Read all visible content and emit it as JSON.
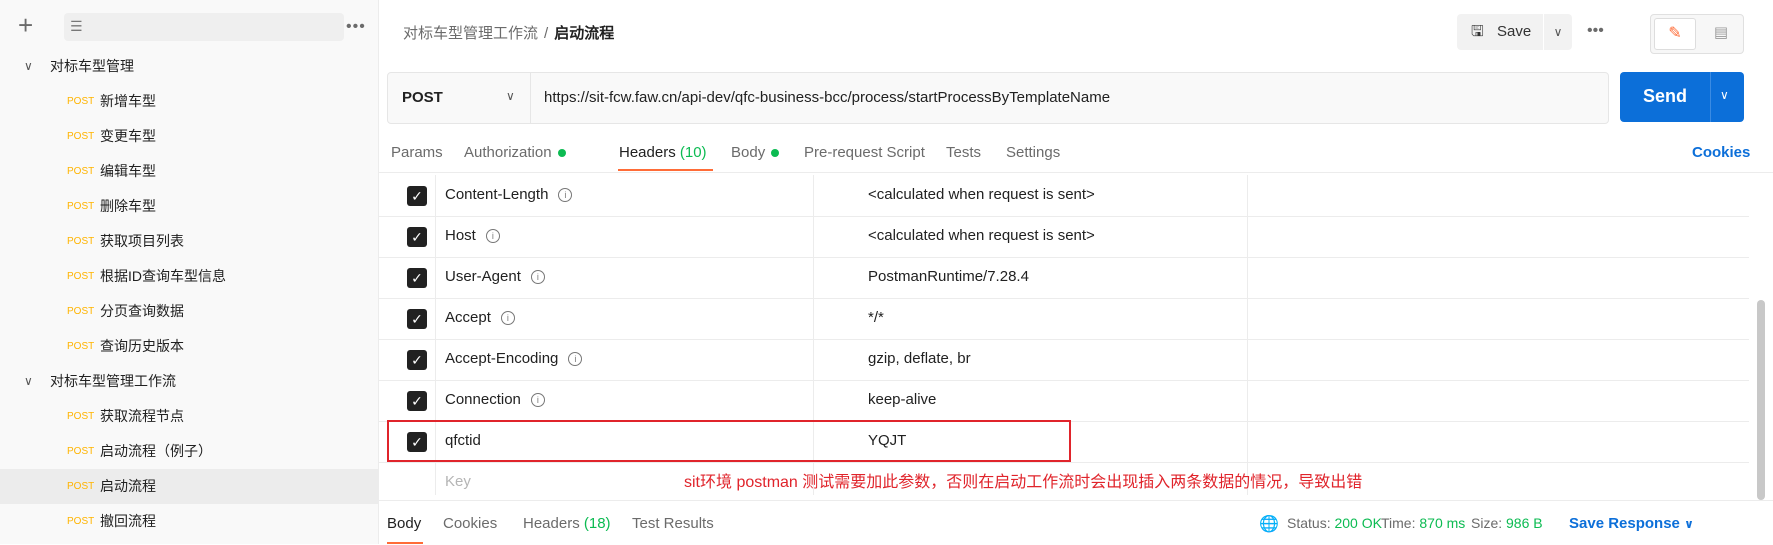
{
  "sidebar": {
    "folders": [
      {
        "label": "对标车型管理"
      },
      {
        "label": "对标车型管理工作流"
      }
    ],
    "requests": [
      {
        "method": "POST",
        "label": "新增车型"
      },
      {
        "method": "POST",
        "label": "变更车型"
      },
      {
        "method": "POST",
        "label": "编辑车型"
      },
      {
        "method": "POST",
        "label": "删除车型"
      },
      {
        "method": "POST",
        "label": "获取项目列表"
      },
      {
        "method": "POST",
        "label": "根据ID查询车型信息"
      },
      {
        "method": "POST",
        "label": "分页查询数据"
      },
      {
        "method": "POST",
        "label": "查询历史版本"
      },
      {
        "method": "POST",
        "label": "获取流程节点"
      },
      {
        "method": "POST",
        "label": "启动流程（例子）"
      },
      {
        "method": "POST",
        "label": "启动流程"
      },
      {
        "method": "POST",
        "label": "撤回流程"
      }
    ],
    "icons": {
      "add": "plus-icon",
      "filter": "filter-icon",
      "more": "more-icon"
    }
  },
  "breadcrumb": {
    "parent": "对标车型管理工作流",
    "separator": "/",
    "current": "启动流程"
  },
  "toolbar": {
    "save_label": "Save"
  },
  "request": {
    "method": "POST",
    "url": "https://sit-fcw.faw.cn/api-dev/qfc-business-bcc/process/startProcessByTemplateName",
    "send_label": "Send"
  },
  "tabs": {
    "params": "Params",
    "authorization": "Authorization",
    "headers": "Headers",
    "headers_count": "(10)",
    "body": "Body",
    "prerequest": "Pre-request Script",
    "tests": "Tests",
    "settings": "Settings",
    "cookies": "Cookies"
  },
  "headers": [
    {
      "key": "Content-Length",
      "value": "<calculated when request is sent>"
    },
    {
      "key": "Host",
      "value": "<calculated when request is sent>"
    },
    {
      "key": "User-Agent",
      "value": "PostmanRuntime/7.28.4"
    },
    {
      "key": "Accept",
      "value": "*/*"
    },
    {
      "key": "Accept-Encoding",
      "value": "gzip, deflate, br"
    },
    {
      "key": "Connection",
      "value": "keep-alive"
    },
    {
      "key": "qfctid",
      "value": "YQJT"
    }
  ],
  "key_placeholder": "Key",
  "annotation": "sit环境 postman 测试需要加此参数，否则在启动工作流时会出现插入两条数据的情况，导致出错",
  "response": {
    "tabs": {
      "body": "Body",
      "cookies": "Cookies",
      "headers": "Headers",
      "headers_count": "(18)",
      "test_results": "Test Results"
    },
    "status_label": "Status:",
    "status_value": "200 OK",
    "time_label": "Time:",
    "time_value": "870 ms",
    "size_label": "Size:",
    "size_value": "986 B",
    "save_response": "Save Response"
  },
  "colors": {
    "accent": "#ff6c37",
    "send": "#0c6fd9",
    "success": "#0cbb52",
    "method_post": "#ffb400",
    "annotation": "#e0242b"
  }
}
